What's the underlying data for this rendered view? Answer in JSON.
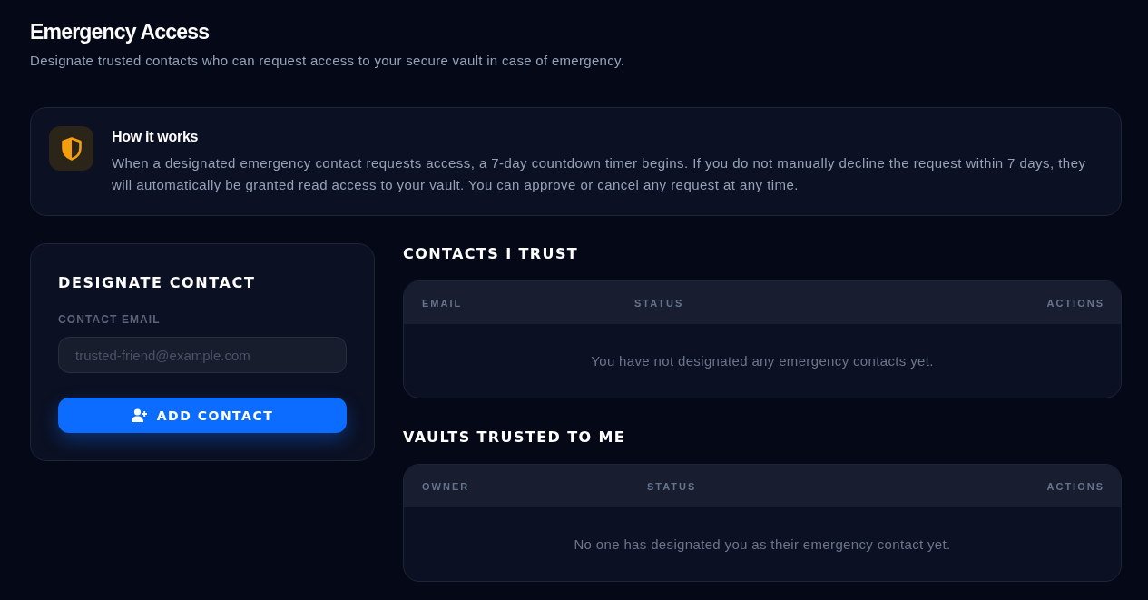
{
  "page": {
    "title": "Emergency Access",
    "subtitle": "Designate trusted contacts who can request access to your secure vault in case of emergency."
  },
  "info_card": {
    "title": "How it works",
    "text": "When a designated emergency contact requests access, a 7-day countdown timer begins. If you do not manually decline the request within 7 days, they will automatically be granted read access to your vault. You can approve or cancel any request at any time."
  },
  "designate_contact": {
    "title": "DESIGNATE CONTACT",
    "email_field": {
      "label": "CONTACT EMAIL",
      "placeholder": "trusted-friend@example.com"
    },
    "add_button": {
      "label": "ADD CONTACT"
    }
  },
  "sections": [
    {
      "title": "CONTACTS I TRUST",
      "table": {
        "columns": [
          "EMAIL",
          "STATUS",
          "ACTIONS"
        ],
        "empty_message": "You have not designated any emergency contacts yet."
      }
    },
    {
      "title": "VAULTS TRUSTED TO ME",
      "table": {
        "columns": [
          "OWNER",
          "STATUS",
          "ACTIONS"
        ],
        "empty_message": "No one has designated you as their emergency contact yet."
      }
    }
  ]
}
